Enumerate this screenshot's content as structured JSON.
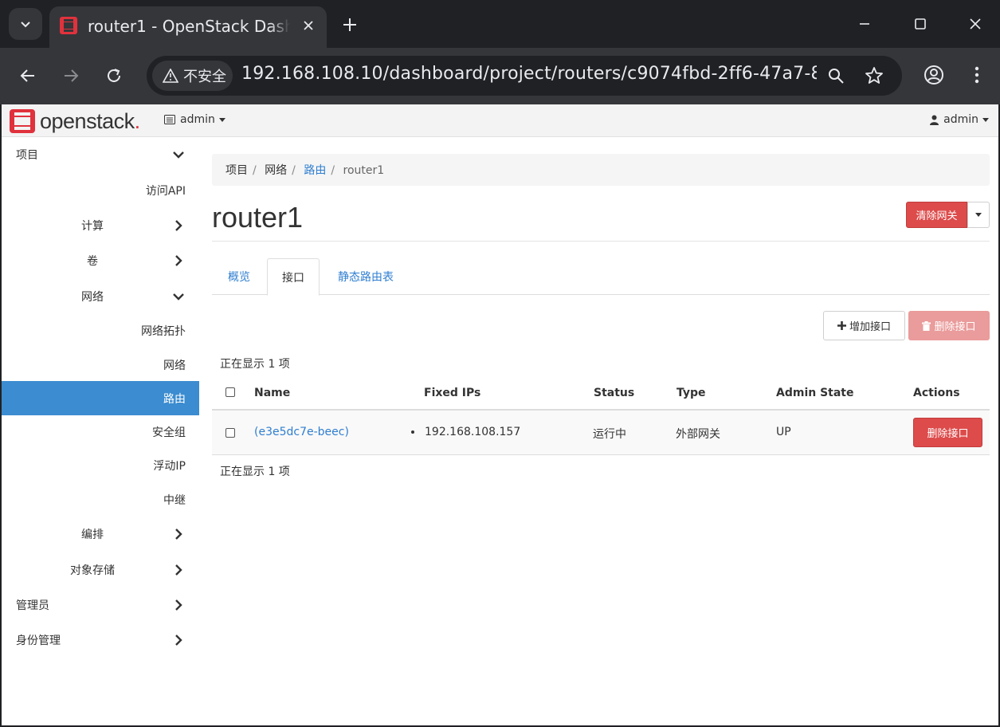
{
  "browser": {
    "tab_title": "router1 - OpenStack Dashboard",
    "security_label": "不安全",
    "url": "192.168.108.10/dashboard/project/routers/c9074fbd-2ff6-47a7-80e5..."
  },
  "topnav": {
    "brand": "openstack",
    "brand_mark": ".",
    "project": "admin",
    "user": "admin"
  },
  "sidebar": {
    "items": [
      {
        "label": "项目"
      },
      {
        "label": "访问API"
      },
      {
        "label": "计算"
      },
      {
        "label": "卷"
      },
      {
        "label": "网络"
      },
      {
        "label": "网络拓扑"
      },
      {
        "label": "网络"
      },
      {
        "label": "路由"
      },
      {
        "label": "安全组"
      },
      {
        "label": "浮动IP"
      },
      {
        "label": "中继"
      },
      {
        "label": "编排"
      },
      {
        "label": "对象存储"
      },
      {
        "label": "管理员"
      },
      {
        "label": "身份管理"
      }
    ]
  },
  "breadcrumb": {
    "items": [
      "项目",
      "网络",
      "路由",
      "router1"
    ]
  },
  "page": {
    "title": "router1",
    "clear_gateway": "清除网关"
  },
  "tabs": [
    {
      "label": "概览"
    },
    {
      "label": "接口"
    },
    {
      "label": "静态路由表"
    }
  ],
  "actions": {
    "add_interface": "增加接口",
    "delete_interfaces": "删除接口"
  },
  "table": {
    "count_text": "正在显示 1 项",
    "columns": [
      "Name",
      "Fixed IPs",
      "Status",
      "Type",
      "Admin State",
      "Actions"
    ],
    "rows": [
      {
        "name": "(e3e5dc7e-beec)",
        "fixed_ip": "192.168.108.157",
        "status": "运行中",
        "type": "外部网关",
        "admin_state": "UP",
        "action": "删除接口"
      }
    ]
  }
}
